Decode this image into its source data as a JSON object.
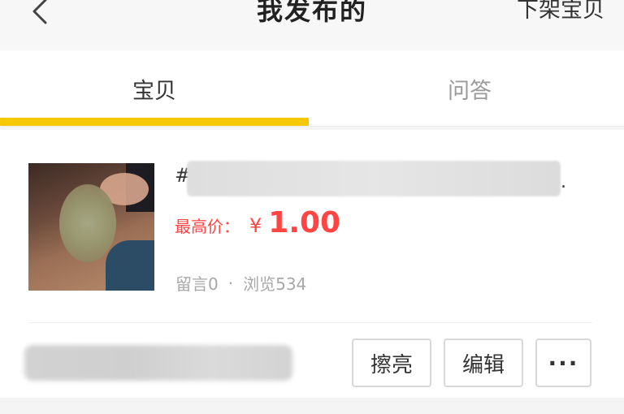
{
  "header": {
    "title": "我发布的",
    "right_action": "下架宝贝",
    "back_icon": "chevron-left-icon"
  },
  "tabs": [
    {
      "label": "宝贝",
      "active": true
    },
    {
      "label": "问答",
      "active": false
    }
  ],
  "colors": {
    "accent": "#f5c800",
    "price": "#ff4444",
    "muted": "#a8a8a8"
  },
  "item": {
    "title_prefix": "#",
    "title_suffix": ".",
    "price_label": "最高价：",
    "currency": "¥",
    "price": "1.00",
    "comments": "留言0",
    "separator": "·",
    "views": "浏览534"
  },
  "actions": {
    "polish": "擦亮",
    "edit": "编辑",
    "more": "···"
  }
}
